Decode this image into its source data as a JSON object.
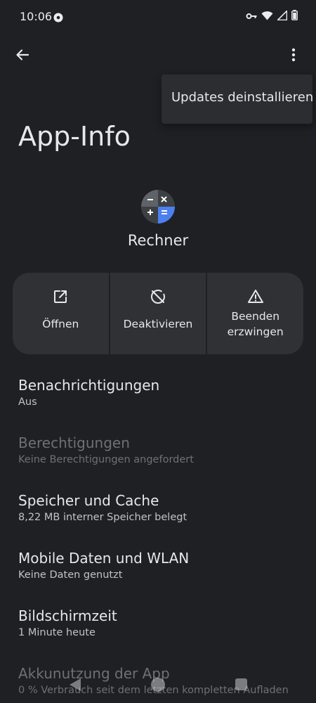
{
  "status_bar": {
    "time": "10:06",
    "icons": [
      "message-icon",
      "vpn-key-icon",
      "wifi-icon",
      "signal-icon",
      "battery-icon"
    ]
  },
  "app_bar": {
    "back_icon": "arrow-back-icon",
    "more_icon": "more-vert-icon"
  },
  "menu": {
    "items": [
      {
        "label": "Updates deinstallieren"
      }
    ]
  },
  "page": {
    "title": "App-Info"
  },
  "app": {
    "name": "Rechner",
    "icon": "calculator-icon",
    "colors": {
      "dark": "#5f6368",
      "blue": "#4c7ff0"
    }
  },
  "actions": [
    {
      "label": "Öffnen",
      "icon": "open-in-new-icon"
    },
    {
      "label": "Deaktivieren",
      "icon": "block-icon"
    },
    {
      "label": "Beenden erzwingen",
      "line1": "Beenden",
      "line2": "erzwingen",
      "icon": "warning-icon"
    }
  ],
  "settings": [
    {
      "title": "Benachrichtigungen",
      "subtitle": "Aus",
      "enabled": true
    },
    {
      "title": "Berechtigungen",
      "subtitle": "Keine Berechtigungen angefordert",
      "enabled": false
    },
    {
      "title": "Speicher und Cache",
      "subtitle": "8,22 MB interner Speicher belegt",
      "enabled": true
    },
    {
      "title": "Mobile Daten und WLAN",
      "subtitle": "Keine Daten genutzt",
      "enabled": true
    },
    {
      "title": "Bildschirmzeit",
      "subtitle": "1 Minute heute",
      "enabled": true
    },
    {
      "title": "Akkunutzung der App",
      "subtitle": "0 % Verbrauch seit dem letzten kompletten Aufladen",
      "enabled": false
    }
  ],
  "nav_bar": {
    "icons": [
      "nav-back-icon",
      "nav-home-icon",
      "nav-recents-icon"
    ]
  },
  "theme": {
    "background": "#1f2023",
    "surface": "#303134",
    "text_primary": "#e8e7eb",
    "text_secondary": "#c3c2c7",
    "text_disabled": "#6f7074"
  }
}
